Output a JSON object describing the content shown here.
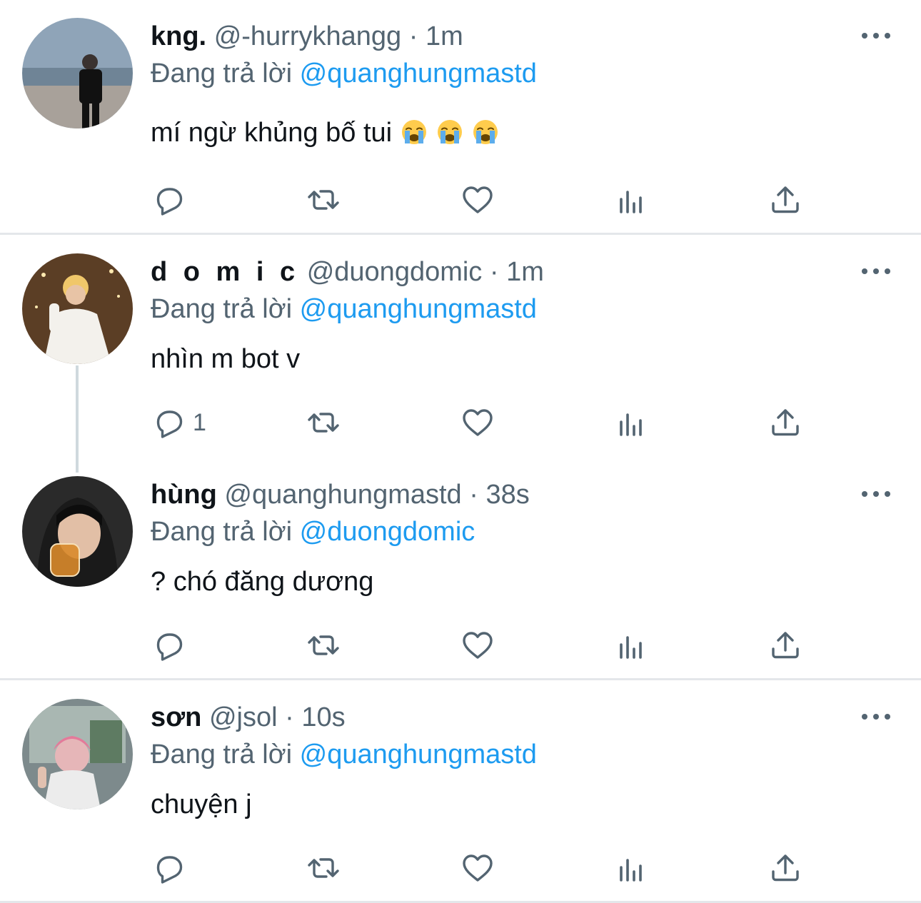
{
  "tweets": [
    {
      "name": "kng.",
      "handle": "@-hurrykhangg",
      "separator": "·",
      "time": "1m",
      "reply_prefix": "Đang trả lời",
      "reply_to": "@quanghungmastd",
      "text": "mí ngừ khủng bố tui",
      "emojis": [
        "loudly-crying-face",
        "loudly-crying-face",
        "loudly-crying-face"
      ],
      "reply_count": ""
    },
    {
      "name": "d o m i c",
      "handle": "@duongdomic",
      "separator": "·",
      "time": "1m",
      "reply_prefix": "Đang trả lời",
      "reply_to": "@quanghungmastd",
      "text": "nhìn m bot v",
      "reply_count": "1"
    },
    {
      "name": "hùng",
      "handle": "@quanghungmastd",
      "separator": "·",
      "time": "38s",
      "reply_prefix": "Đang trả lời",
      "reply_to": "@duongdomic",
      "text": "? chó đăng dương",
      "reply_count": ""
    },
    {
      "name": "sơn",
      "handle": "@jsol",
      "separator": "·",
      "time": "10s",
      "reply_prefix": "Đang trả lời",
      "reply_to": "@quanghungmastd",
      "text": "chuyện j",
      "reply_count": ""
    }
  ],
  "icons": {
    "reply": "reply-icon",
    "retweet": "retweet-icon",
    "like": "heart-icon",
    "views": "views-icon",
    "share": "share-icon",
    "more": "more-icon"
  },
  "colors": {
    "link": "#1d9bf0",
    "secondary_text": "#536471",
    "primary_text": "#0f1419",
    "divider": "#e4e7ea",
    "thread_line": "#cfd9de"
  }
}
